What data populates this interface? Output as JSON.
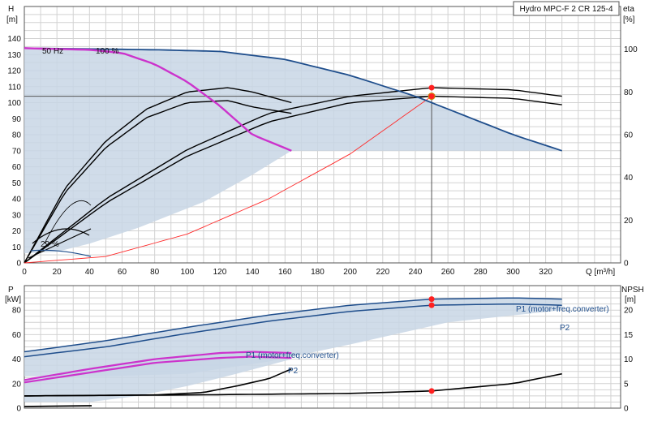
{
  "chart_data": [
    {
      "id": "head",
      "type": "line",
      "title": "Hydro MPC-F 2 CR 125-4",
      "ylabel_left": "H",
      "yunit_left": "[m]",
      "ylabel_right": "eta",
      "yunit_right": "[%]",
      "xlabel": "Q [m³/h]",
      "x_ticks": [
        "0",
        "20",
        "40",
        "60",
        "80",
        "100",
        "120",
        "140",
        "160",
        "180",
        "200",
        "220",
        "240",
        "260",
        "280",
        "300",
        "320"
      ],
      "y_ticks_left": [
        "0",
        "10",
        "20",
        "30",
        "40",
        "50",
        "60",
        "70",
        "80",
        "90",
        "100",
        "110",
        "120",
        "130",
        "140"
      ],
      "y_ticks_right": [
        "0",
        "20",
        "40",
        "60",
        "80",
        "100"
      ],
      "xlim": [
        0,
        366
      ],
      "ylim_left": [
        0,
        160
      ],
      "ylim_right": [
        0,
        120
      ],
      "grid": true,
      "annotations": {
        "freq": "50 Hz",
        "speed_max": "100 %",
        "speed_min": "29 %"
      },
      "operating_point": {
        "q": 250,
        "h": 104
      },
      "series": [
        {
          "name": "",
          "kind": "h_two_pumps",
          "color": "#1f4e8c",
          "x": [
            0,
            40,
            80,
            120,
            160,
            200,
            240,
            260,
            300,
            330
          ],
          "y": [
            134,
            133.5,
            133,
            132,
            127,
            117,
            104,
            96,
            80,
            70
          ]
        },
        {
          "name": "",
          "kind": "h_one_pump",
          "color": "#cc33cc",
          "x": [
            0,
            20,
            40,
            60,
            80,
            100,
            120,
            140,
            164
          ],
          "y": [
            134,
            133.5,
            133,
            131,
            124,
            113,
            98,
            80,
            70
          ]
        },
        {
          "name": "",
          "kind": "system_curve",
          "color": "#ff2a2a",
          "x": [
            0,
            50,
            100,
            150,
            200,
            250
          ],
          "y": [
            0,
            4,
            18,
            40,
            68,
            104
          ]
        },
        {
          "name": "",
          "kind": "eta_total_2",
          "color": "#000000",
          "x": [
            0,
            50,
            100,
            150,
            200,
            250,
            300,
            330
          ],
          "y": [
            0,
            30,
            53,
            70,
            78,
            82,
            81,
            78
          ]
        },
        {
          "name": "",
          "kind": "eta_pump_2",
          "color": "#000000",
          "x": [
            0,
            50,
            100,
            150,
            200,
            250,
            300,
            330
          ],
          "y": [
            0,
            28,
            50,
            66,
            75,
            78,
            77,
            74
          ]
        },
        {
          "name": "",
          "kind": "eta_total_1",
          "color": "#000000",
          "x": [
            0,
            25,
            50,
            75,
            100,
            125,
            140,
            164
          ],
          "y": [
            0,
            35,
            57,
            72,
            80,
            82,
            80,
            75
          ]
        },
        {
          "name": "",
          "kind": "eta_pump_1",
          "color": "#000000",
          "x": [
            0,
            25,
            50,
            75,
            100,
            125,
            140,
            164
          ],
          "y": [
            0,
            33,
            54,
            68,
            75,
            76,
            73,
            70
          ]
        }
      ]
    },
    {
      "id": "power",
      "type": "line",
      "ylabel_left": "P",
      "yunit_left": "[kW]",
      "ylabel_right": "NPSH",
      "yunit_right": "[m]",
      "y_ticks_left": [
        "0",
        "20",
        "40",
        "60",
        "80"
      ],
      "y_ticks_right": [
        "0",
        "5",
        "10",
        "15",
        "20"
      ],
      "xlim": [
        0,
        366
      ],
      "ylim_left": [
        0,
        100
      ],
      "ylim_right": [
        0,
        25
      ],
      "grid": true,
      "labels": {
        "p1": "P1 (motor+freq.converter)",
        "p2": "P2"
      },
      "series": [
        {
          "name": "P1 (motor+freq.converter)",
          "kind": "p1_two_pumps",
          "color": "#1f4e8c",
          "x": [
            0,
            50,
            100,
            150,
            200,
            250,
            300,
            330
          ],
          "y": [
            46,
            55,
            66,
            76,
            84,
            89,
            90,
            89
          ]
        },
        {
          "name": "P2",
          "kind": "p2_two_pumps",
          "color": "#1f4e8c",
          "x": [
            0,
            50,
            100,
            150,
            200,
            250,
            300,
            330
          ],
          "y": [
            42,
            50,
            61,
            71,
            79,
            84,
            85,
            84
          ]
        },
        {
          "name": "P1 (motor+freq.converter)",
          "kind": "p1_one_pump",
          "color": "#cc33cc",
          "x": [
            0,
            40,
            80,
            120,
            140,
            164
          ],
          "y": [
            23,
            32,
            40,
            45,
            46,
            45
          ]
        },
        {
          "name": "P2",
          "kind": "p2_one_pump",
          "color": "#cc33cc",
          "x": [
            0,
            40,
            80,
            120,
            140,
            164
          ],
          "y": [
            21,
            29,
            37,
            41,
            42,
            41
          ]
        },
        {
          "name": "",
          "kind": "npsh_two_pumps",
          "color": "#000000",
          "axis": "right",
          "x": [
            0,
            100,
            200,
            250,
            300,
            330
          ],
          "y": [
            2.5,
            2.7,
            3,
            3.5,
            5,
            7
          ]
        },
        {
          "name": "",
          "kind": "npsh_one_pump",
          "color": "#000000",
          "axis": "right",
          "x": [
            0,
            80,
            110,
            130,
            150,
            164
          ],
          "y": [
            2.5,
            2.7,
            3.2,
            4.5,
            6,
            8
          ]
        }
      ],
      "operating_points": [
        {
          "q": 250,
          "p": 89
        },
        {
          "q": 250,
          "p": 84
        }
      ],
      "npsh_point": {
        "q": 250,
        "npsh": 3.5
      }
    }
  ]
}
